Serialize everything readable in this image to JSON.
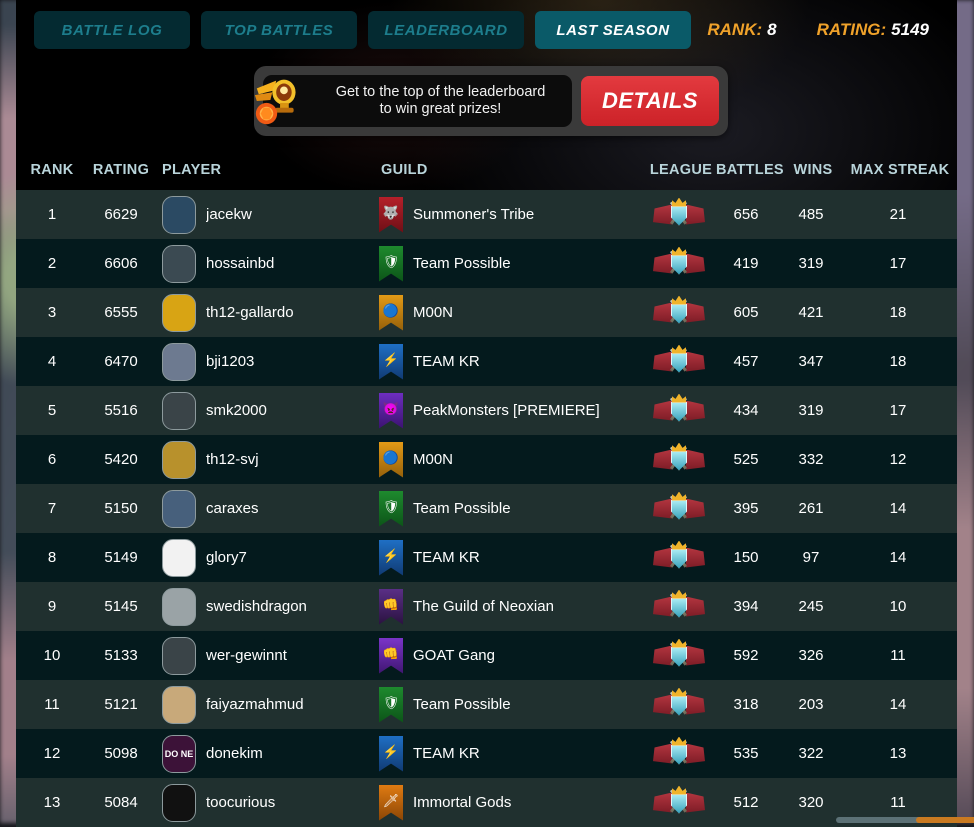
{
  "nav": {
    "tabs": [
      {
        "label": "BATTLE LOG",
        "active": false
      },
      {
        "label": "TOP BATTLES",
        "active": false
      },
      {
        "label": "LEADERBOARD",
        "active": false
      },
      {
        "label": "LAST SEASON",
        "active": true
      }
    ],
    "rank_label": "RANK:",
    "rank_value": "8",
    "rating_label": "RATING:",
    "rating_value": "5149",
    "accent_gold": "#f0a22a",
    "accent_teal": "#0a5a68"
  },
  "promo": {
    "icon": "winged-trophy-icon",
    "line1": "Get to the top of the leaderboard",
    "line2": "to win great prizes!",
    "details_label": "DETAILS",
    "details_color": "#e33a3f"
  },
  "table": {
    "columns": [
      "RANK",
      "RATING",
      "PLAYER",
      "GUILD",
      "LEAGUE",
      "BATTLES",
      "WINS",
      "MAX STREAK"
    ],
    "rows": [
      {
        "rank": "1",
        "rating": "6629",
        "player": "jacekw",
        "avatar_bg": "#2b4a63",
        "avatar_txt": "",
        "guild": "Summoner's Tribe",
        "banner_from": "#b5202a",
        "banner_to": "#6d0f16",
        "banner_emblem": "🐺",
        "league": "champion-league-icon",
        "battles": "656",
        "wins": "485",
        "streak": "21"
      },
      {
        "rank": "2",
        "rating": "6606",
        "player": "hossainbd",
        "avatar_bg": "#3b4a52",
        "avatar_txt": "",
        "guild": "Team Possible",
        "banner_from": "#1e8a2e",
        "banner_to": "#0c5418",
        "banner_emblem": "🛡",
        "league": "champion-league-icon",
        "battles": "419",
        "wins": "319",
        "streak": "17"
      },
      {
        "rank": "3",
        "rating": "6555",
        "player": "th12-gallardo",
        "avatar_bg": "#d8a414",
        "avatar_txt": "",
        "guild": "M00N",
        "banner_from": "#e39a16",
        "banner_to": "#95600a",
        "banner_emblem": "🔵",
        "league": "champion-league-icon",
        "battles": "605",
        "wins": "421",
        "streak": "18"
      },
      {
        "rank": "4",
        "rating": "6470",
        "player": "bji1203",
        "avatar_bg": "#6d7a90",
        "avatar_txt": "",
        "guild": "TEAM KR",
        "banner_from": "#1f6fc4",
        "banner_to": "#103a72",
        "banner_emblem": "⚡",
        "league": "champion-league-icon",
        "battles": "457",
        "wins": "347",
        "streak": "18"
      },
      {
        "rank": "5",
        "rating": "5516",
        "player": "smk2000",
        "avatar_bg": "#3a4448",
        "avatar_txt": "",
        "guild": "PeakMonsters [PREMIERE]",
        "banner_from": "#6d2ec0",
        "banner_to": "#3b1270",
        "banner_emblem": "👿",
        "league": "champion-league-icon",
        "battles": "434",
        "wins": "319",
        "streak": "17"
      },
      {
        "rank": "6",
        "rating": "5420",
        "player": "th12-svj",
        "avatar_bg": "#b8912c",
        "avatar_txt": "",
        "guild": "M00N",
        "banner_from": "#e39a16",
        "banner_to": "#95600a",
        "banner_emblem": "🔵",
        "league": "champion-league-icon",
        "battles": "525",
        "wins": "332",
        "streak": "12"
      },
      {
        "rank": "7",
        "rating": "5150",
        "player": "caraxes",
        "avatar_bg": "#47607c",
        "avatar_txt": "",
        "guild": "Team Possible",
        "banner_from": "#1e8a2e",
        "banner_to": "#0c5418",
        "banner_emblem": "🛡",
        "league": "champion-league-icon",
        "battles": "395",
        "wins": "261",
        "streak": "14"
      },
      {
        "rank": "8",
        "rating": "5149",
        "player": "glory7",
        "avatar_bg": "#f2f2f2",
        "avatar_txt": "",
        "guild": "TEAM KR",
        "banner_from": "#1f6fc4",
        "banner_to": "#103a72",
        "banner_emblem": "⚡",
        "league": "champion-league-icon",
        "battles": "150",
        "wins": "97",
        "streak": "14"
      },
      {
        "rank": "9",
        "rating": "5145",
        "player": "swedishdragon",
        "avatar_bg": "#9aa3a6",
        "avatar_txt": "",
        "guild": "The Guild of Neoxian",
        "banner_from": "#5a2f86",
        "banner_to": "#2a123f",
        "banner_emblem": "👊",
        "league": "champion-league-icon",
        "battles": "394",
        "wins": "245",
        "streak": "10"
      },
      {
        "rank": "10",
        "rating": "5133",
        "player": "wer-gewinnt",
        "avatar_bg": "#3a4448",
        "avatar_txt": "",
        "guild": "GOAT Gang",
        "banner_from": "#7b35c9",
        "banner_to": "#3f1670",
        "banner_emblem": "👊",
        "league": "champion-league-icon",
        "battles": "592",
        "wins": "326",
        "streak": "11"
      },
      {
        "rank": "11",
        "rating": "5121",
        "player": "faiyazmahmud",
        "avatar_bg": "#c8a97a",
        "avatar_txt": "",
        "guild": "Team Possible",
        "banner_from": "#1e8a2e",
        "banner_to": "#0c5418",
        "banner_emblem": "🛡",
        "league": "champion-league-icon",
        "battles": "318",
        "wins": "203",
        "streak": "14"
      },
      {
        "rank": "12",
        "rating": "5098",
        "player": "donekim",
        "avatar_bg": "#3c1238",
        "avatar_txt": "DO NE",
        "guild": "TEAM KR",
        "banner_from": "#1f6fc4",
        "banner_to": "#103a72",
        "banner_emblem": "⚡",
        "league": "champion-league-icon",
        "battles": "535",
        "wins": "322",
        "streak": "13"
      },
      {
        "rank": "13",
        "rating": "5084",
        "player": "toocurious",
        "avatar_bg": "#111111",
        "avatar_txt": "",
        "guild": "Immortal Gods",
        "banner_from": "#e07b12",
        "banner_to": "#8a4505",
        "banner_emblem": "🗡",
        "league": "champion-league-icon",
        "battles": "512",
        "wins": "320",
        "streak": "11"
      }
    ]
  }
}
